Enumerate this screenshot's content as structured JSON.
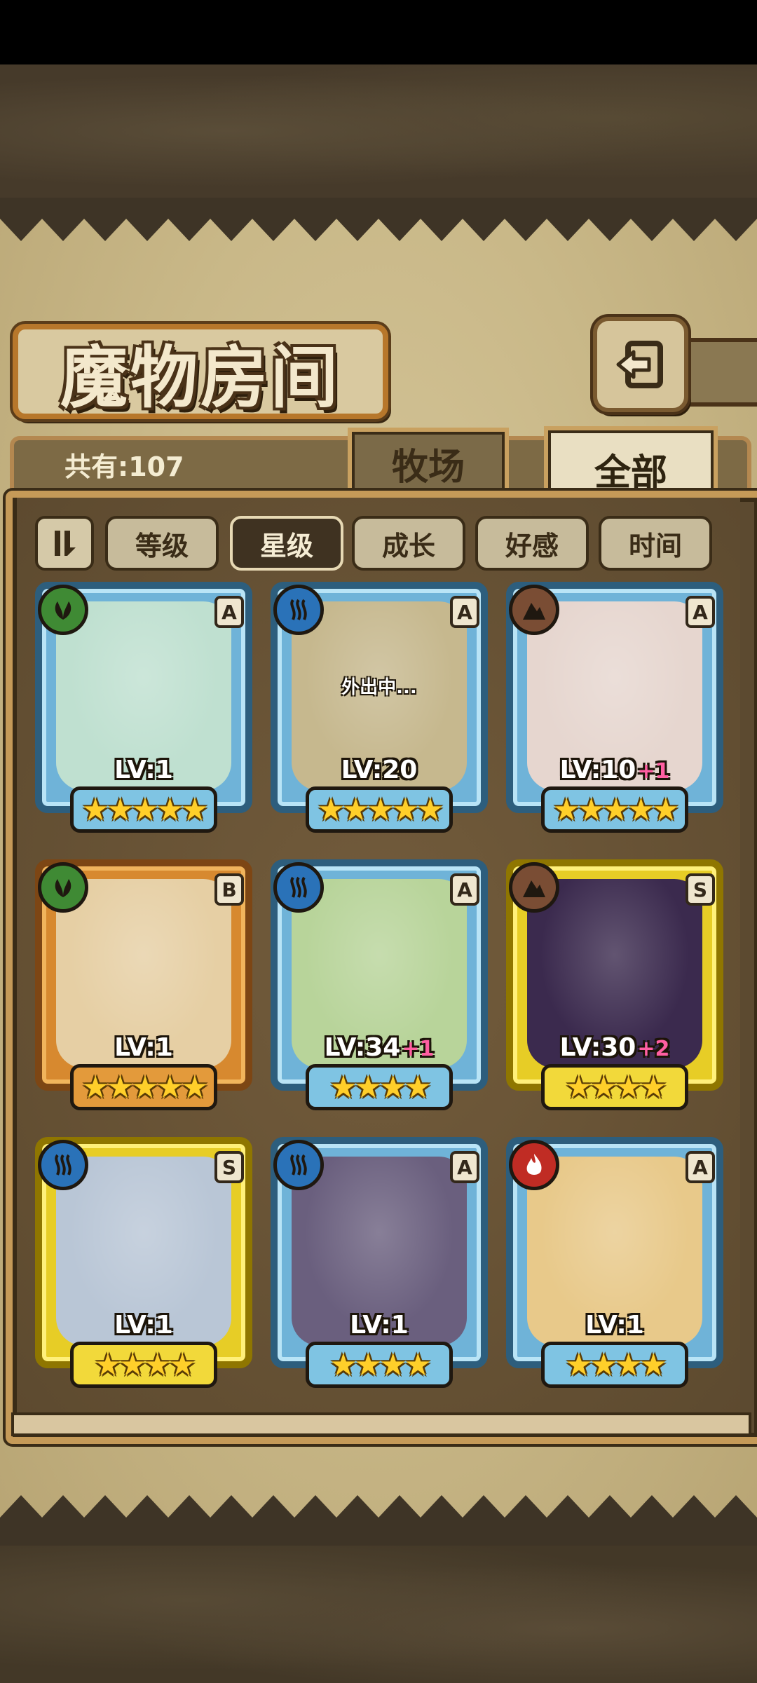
{
  "header": {
    "title": "魔物房间"
  },
  "tabs": {
    "total_count": "共有:107",
    "ranch": "牧场",
    "all": "全部"
  },
  "filters": [
    {
      "label": "等级",
      "active": false
    },
    {
      "label": "星级",
      "active": true
    },
    {
      "label": "成长",
      "active": false
    },
    {
      "label": "好感",
      "active": false
    },
    {
      "label": "时间",
      "active": false
    }
  ],
  "monsters": [
    {
      "element": "grass-icon",
      "rank": "A",
      "level": "LV:1",
      "bonus": "",
      "stars": "★★★★★",
      "status": "",
      "portrait": "#bfe0d0"
    },
    {
      "element": "water-icon",
      "rank": "A",
      "level": "LV:20",
      "bonus": "",
      "stars": "★★★★★",
      "status": "外出中...",
      "portrait": "#c6b88e"
    },
    {
      "element": "earth-icon",
      "rank": "A",
      "level": "LV:10",
      "bonus": "+1",
      "stars": "★★★★★",
      "status": "",
      "portrait": "#e6d6cf"
    },
    {
      "element": "grass-icon",
      "rank": "B",
      "level": "LV:1",
      "bonus": "",
      "stars": "★★★★★",
      "status": "",
      "portrait": "#e6cfa4"
    },
    {
      "element": "water-icon",
      "rank": "A",
      "level": "LV:34",
      "bonus": "+1",
      "stars": "★★★★",
      "status": "",
      "portrait": "#b8d49a"
    },
    {
      "element": "earth-icon",
      "rank": "S",
      "level": "LV:30",
      "bonus": "+2",
      "stars": "★★★★",
      "status": "",
      "portrait": "#3b2a4e"
    },
    {
      "element": "water-icon",
      "rank": "S",
      "level": "LV:1",
      "bonus": "",
      "stars": "★★★★",
      "status": "",
      "portrait": "#b9c6d6"
    },
    {
      "element": "water-icon",
      "rank": "A",
      "level": "LV:1",
      "bonus": "",
      "stars": "★★★★",
      "status": "",
      "portrait": "#6a5f7e"
    },
    {
      "element": "fire-icon",
      "rank": "A",
      "level": "LV:1",
      "bonus": "",
      "stars": "★★★★",
      "status": "",
      "portrait": "#e8c98a"
    }
  ]
}
